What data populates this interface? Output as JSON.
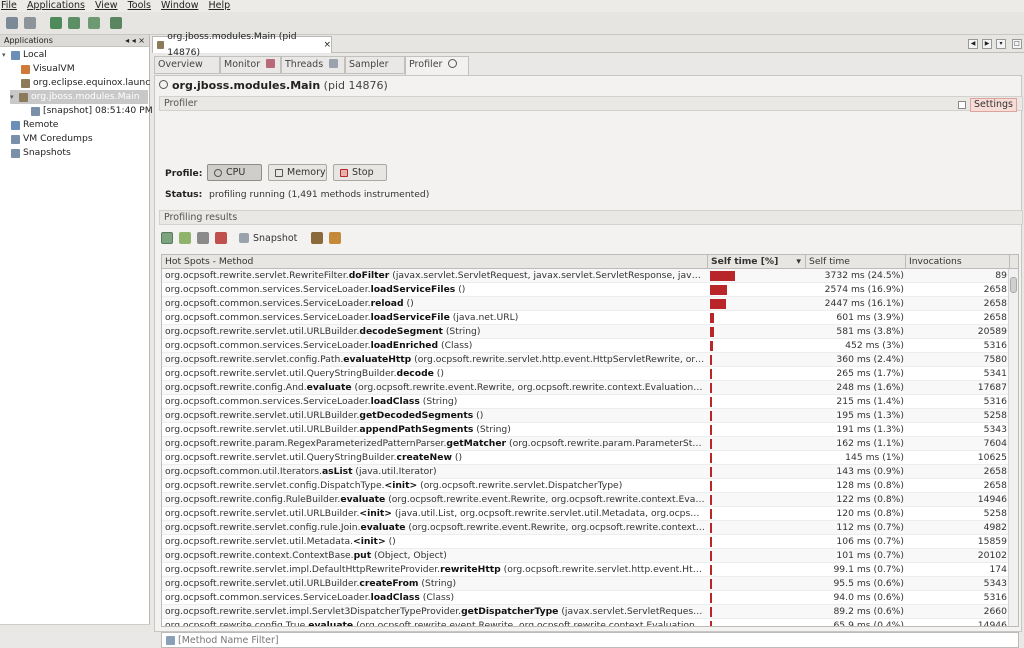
{
  "menu": [
    "File",
    "Applications",
    "View",
    "Tools",
    "Window",
    "Help"
  ],
  "left_panel": {
    "title": "Applications",
    "controls": "◂ ◂ ×",
    "tree": [
      {
        "label": "Local",
        "depth": 0,
        "expander": "▾",
        "icon_color": "#6b8fb7"
      },
      {
        "label": "VisualVM",
        "depth": 1,
        "expander": "",
        "icon_color": "#d07a3a"
      },
      {
        "label": "org.eclipse.equinox.launc",
        "depth": 1,
        "expander": "",
        "icon_color": "#8b7b5a"
      },
      {
        "label": "org.jboss.modules.Main",
        "depth": 1,
        "expander": "▾",
        "icon_color": "#8b7b5a",
        "selected": true
      },
      {
        "label": "[snapshot] 08:51:40 PM",
        "depth": 2,
        "expander": "",
        "icon_color": "#7a8fa8"
      },
      {
        "label": "Remote",
        "depth": 0,
        "expander": "",
        "icon_color": "#6b8fb7"
      },
      {
        "label": "VM Coredumps",
        "depth": 0,
        "expander": "",
        "icon_color": "#7a8fa8"
      },
      {
        "label": "Snapshots",
        "depth": 0,
        "expander": "",
        "icon_color": "#7a8fa8"
      }
    ]
  },
  "doc_tab": {
    "label": "org.jboss.modules.Main (pid 14876)",
    "close": "×"
  },
  "subtabs": [
    {
      "label": "Overview",
      "active": false
    },
    {
      "label": "Monitor",
      "active": false
    },
    {
      "label": "Threads",
      "active": false
    },
    {
      "label": "Sampler",
      "active": false
    },
    {
      "label": "Profiler",
      "active": true
    }
  ],
  "profiler": {
    "title_name": "org.jboss.modules.Main",
    "title_pid": "(pid 14876)",
    "section_profiler": "Profiler",
    "settings_label": "Settings",
    "profile_label": "Profile:",
    "cpu_label": "CPU",
    "memory_label": "Memory",
    "stop_label": "Stop",
    "status_label": "Status:",
    "status_value": "profiling running (1,491 methods instrumented)",
    "section_results": "Profiling results",
    "snapshot_label": "Snapshot",
    "filter_placeholder": "[Method Name Filter]"
  },
  "table": {
    "columns": [
      "Hot Spots - Method",
      "Self time [%]",
      "Self time",
      "Invocations"
    ],
    "sort_indicator": "▾",
    "rows": [
      {
        "pkg": "org.ocpsoft.rewrite.servlet.RewriteFilter.",
        "method": "doFilter",
        "args": " (javax.servlet.ServletRequest, javax.servlet.ServletResponse, javax.serv...",
        "self_time": "3732 ms (24.5%)",
        "pct": 24.5,
        "invocations": "89"
      },
      {
        "pkg": "org.ocpsoft.common.services.ServiceLoader.",
        "method": "loadServiceFiles",
        "args": " ()",
        "self_time": "2574 ms (16.9%)",
        "pct": 16.9,
        "invocations": "2658"
      },
      {
        "pkg": "org.ocpsoft.common.services.ServiceLoader.",
        "method": "reload",
        "args": " ()",
        "self_time": "2447 ms (16.1%)",
        "pct": 16.1,
        "invocations": "2658"
      },
      {
        "pkg": "org.ocpsoft.common.services.ServiceLoader.",
        "method": "loadServiceFile",
        "args": " (java.net.URL)",
        "self_time": "601 ms (3.9%)",
        "pct": 3.9,
        "invocations": "2658"
      },
      {
        "pkg": "org.ocpsoft.rewrite.servlet.util.URLBuilder.",
        "method": "decodeSegment",
        "args": " (String)",
        "self_time": "581 ms (3.8%)",
        "pct": 3.8,
        "invocations": "20589"
      },
      {
        "pkg": "org.ocpsoft.common.services.ServiceLoader.",
        "method": "loadEnriched",
        "args": " (Class)",
        "self_time": "452 ms (3%)",
        "pct": 3.0,
        "invocations": "5316"
      },
      {
        "pkg": "org.ocpsoft.rewrite.servlet.config.Path.",
        "method": "evaluateHttp",
        "args": " (org.ocpsoft.rewrite.servlet.http.event.HttpServletRewrite, org.o...",
        "self_time": "360 ms (2.4%)",
        "pct": 2.4,
        "invocations": "7580"
      },
      {
        "pkg": "org.ocpsoft.rewrite.servlet.util.QueryStringBuilder.",
        "method": "decode",
        "args": " ()",
        "self_time": "265 ms (1.7%)",
        "pct": 1.7,
        "invocations": "5341"
      },
      {
        "pkg": "org.ocpsoft.rewrite.config.And.",
        "method": "evaluate",
        "args": " (org.ocpsoft.rewrite.event.Rewrite, org.ocpsoft.rewrite.context.EvaluationCo...",
        "self_time": "248 ms (1.6%)",
        "pct": 1.6,
        "invocations": "17687"
      },
      {
        "pkg": "org.ocpsoft.common.services.ServiceLoader.",
        "method": "loadClass",
        "args": " (String)",
        "self_time": "215 ms (1.4%)",
        "pct": 1.4,
        "invocations": "5316"
      },
      {
        "pkg": "org.ocpsoft.rewrite.servlet.util.URLBuilder.",
        "method": "getDecodedSegments",
        "args": " ()",
        "self_time": "195 ms (1.3%)",
        "pct": 1.3,
        "invocations": "5258"
      },
      {
        "pkg": "org.ocpsoft.rewrite.servlet.util.URLBuilder.",
        "method": "appendPathSegments",
        "args": " (String)",
        "self_time": "191 ms (1.3%)",
        "pct": 1.3,
        "invocations": "5343"
      },
      {
        "pkg": "org.ocpsoft.rewrite.param.RegexParameterizedPatternParser.",
        "method": "getMatcher",
        "args": " (org.ocpsoft.rewrite.param.ParameterStore,...",
        "self_time": "162 ms (1.1%)",
        "pct": 1.1,
        "invocations": "7604"
      },
      {
        "pkg": "org.ocpsoft.rewrite.servlet.util.QueryStringBuilder.",
        "method": "createNew",
        "args": " ()",
        "self_time": "145 ms (1%)",
        "pct": 1.0,
        "invocations": "10625"
      },
      {
        "pkg": "org.ocpsoft.common.util.Iterators.",
        "method": "asList",
        "args": " (java.util.Iterator)",
        "self_time": "143 ms (0.9%)",
        "pct": 0.9,
        "invocations": "2658"
      },
      {
        "pkg": "org.ocpsoft.rewrite.servlet.config.DispatchType.",
        "method": "<init>",
        "args": " (org.ocpsoft.rewrite.servlet.DispatcherType)",
        "self_time": "128 ms (0.8%)",
        "pct": 0.8,
        "invocations": "2658"
      },
      {
        "pkg": "org.ocpsoft.rewrite.config.RuleBuilder.",
        "method": "evaluate",
        "args": " (org.ocpsoft.rewrite.event.Rewrite, org.ocpsoft.rewrite.context.Evalu...",
        "self_time": "122 ms (0.8%)",
        "pct": 0.8,
        "invocations": "14946"
      },
      {
        "pkg": "org.ocpsoft.rewrite.servlet.util.URLBuilder.",
        "method": "<init>",
        "args": " (java.util.List, org.ocpsoft.rewrite.servlet.util.Metadata, org.ocpsoft.re...",
        "self_time": "120 ms (0.8%)",
        "pct": 0.8,
        "invocations": "5258"
      },
      {
        "pkg": "org.ocpsoft.rewrite.servlet.config.rule.Join.",
        "method": "evaluate",
        "args": " (org.ocpsoft.rewrite.event.Rewrite, org.ocpsoft.rewrite.context.E...",
        "self_time": "112 ms (0.7%)",
        "pct": 0.7,
        "invocations": "4982"
      },
      {
        "pkg": "org.ocpsoft.rewrite.servlet.util.Metadata.",
        "method": "<init>",
        "args": " ()",
        "self_time": "106 ms (0.7%)",
        "pct": 0.7,
        "invocations": "15859"
      },
      {
        "pkg": "org.ocpsoft.rewrite.context.ContextBase.",
        "method": "put",
        "args": " (Object, Object)",
        "self_time": "101 ms (0.7%)",
        "pct": 0.7,
        "invocations": "20102"
      },
      {
        "pkg": "org.ocpsoft.rewrite.servlet.impl.DefaultHttpRewriteProvider.",
        "method": "rewriteHttp",
        "args": " (org.ocpsoft.rewrite.servlet.http.event.HttpS...",
        "self_time": "99.1 ms (0.7%)",
        "pct": 0.7,
        "invocations": "174"
      },
      {
        "pkg": "org.ocpsoft.rewrite.servlet.util.URLBuilder.",
        "method": "createFrom",
        "args": " (String)",
        "self_time": "95.5 ms (0.6%)",
        "pct": 0.6,
        "invocations": "5343"
      },
      {
        "pkg": "org.ocpsoft.common.services.ServiceLoader.",
        "method": "loadClass",
        "args": " (Class)",
        "self_time": "94.0 ms (0.6%)",
        "pct": 0.6,
        "invocations": "5316"
      },
      {
        "pkg": "org.ocpsoft.rewrite.servlet.impl.Servlet3DispatcherTypeProvider.",
        "method": "getDispatcherType",
        "args": " (javax.servlet.ServletRequest, javax...",
        "self_time": "89.2 ms (0.6%)",
        "pct": 0.6,
        "invocations": "2660"
      },
      {
        "pkg": "org.ocpsoft.rewrite.config.True.",
        "method": "evaluate",
        "args": " (org.ocpsoft.rewrite.event.Rewrite, org.ocpsoft.rewrite.context.EvaluationCo...",
        "self_time": "65.9 ms (0.4%)",
        "pct": 0.4,
        "invocations": "14946"
      }
    ]
  },
  "colors": {
    "bar": "#b8262a",
    "accent": "#d9a59c"
  }
}
